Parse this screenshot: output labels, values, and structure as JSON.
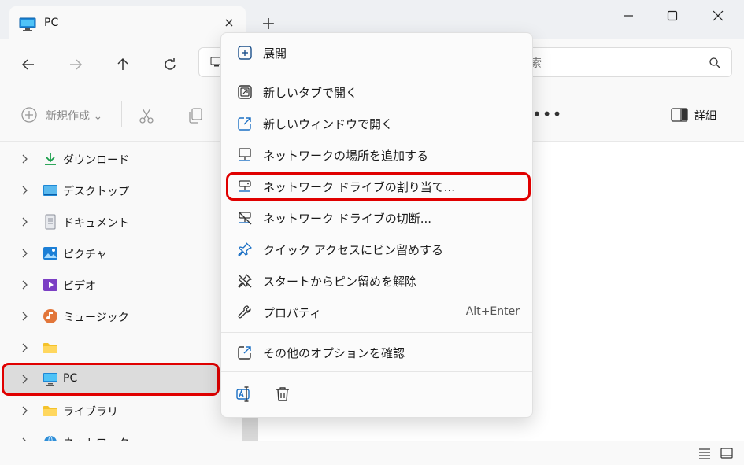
{
  "window": {
    "tab_title": "PC",
    "tab_close": "×",
    "new_tab": "+"
  },
  "search": {
    "text": "索"
  },
  "toolbar": {
    "new_label": "新規作成",
    "new_chevron": "⌄",
    "more": "•••",
    "details_label": "詳細"
  },
  "sidebar": {
    "items": [
      {
        "label": "ダウンロード",
        "icon": "download-icon"
      },
      {
        "label": "デスクトップ",
        "icon": "desktop-icon"
      },
      {
        "label": "ドキュメント",
        "icon": "document-icon"
      },
      {
        "label": "ピクチャ",
        "icon": "pictures-icon"
      },
      {
        "label": "ビデオ",
        "icon": "video-icon"
      },
      {
        "label": "ミュージック",
        "icon": "music-icon"
      },
      {
        "label": "",
        "icon": "folder-icon"
      },
      {
        "label": "PC",
        "icon": "pc-icon",
        "selected": true
      },
      {
        "label": "ライブラリ",
        "icon": "library-icon"
      },
      {
        "label": "ネットワーク",
        "icon": "network-icon"
      }
    ]
  },
  "context_menu": {
    "expand": "展開",
    "open_new_tab": "新しいタブで開く",
    "open_new_window": "新しいウィンドウで開く",
    "add_network_location": "ネットワークの場所を追加する",
    "map_network_drive": "ネットワーク ドライブの割り当て...",
    "disconnect_network_drive": "ネットワーク ドライブの切断...",
    "pin_quick_access": "クイック アクセスにピン留めする",
    "unpin_start": "スタートからピン留めを解除",
    "properties": "プロパティ",
    "properties_shortcut": "Alt+Enter",
    "more_options": "その他のオプションを確認"
  },
  "colors": {
    "highlight": "#e00000",
    "accent": "#0067c0"
  }
}
